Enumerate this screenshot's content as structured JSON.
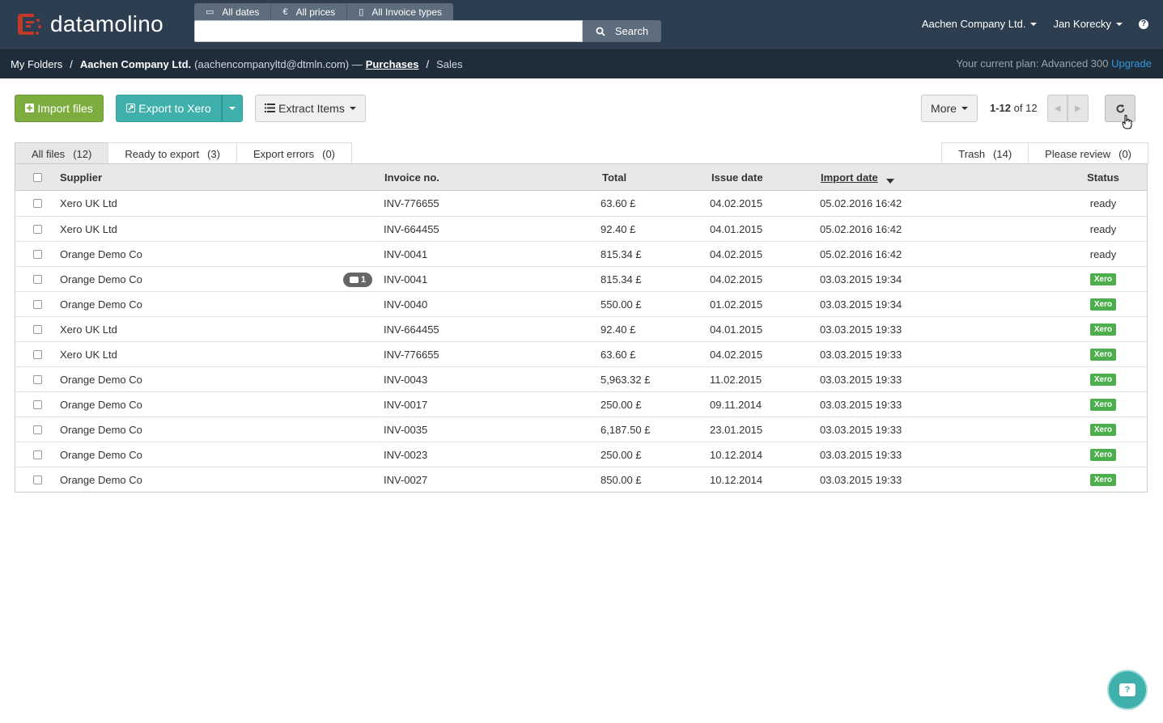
{
  "app": {
    "logo_text": "datamolino",
    "brand_color": "#c0392b"
  },
  "filters": [
    {
      "icon": "calendar-icon",
      "glyph": "▭",
      "label": "All dates"
    },
    {
      "icon": "euro-icon",
      "glyph": "€",
      "label": "All prices"
    },
    {
      "icon": "file-icon",
      "glyph": "▯",
      "label": "All Invoice types"
    }
  ],
  "search": {
    "value": "",
    "placeholder": "",
    "button_label": "Search"
  },
  "topnav": {
    "company": "Aachen Company Ltd.",
    "user": "Jan Korecky",
    "help": "?"
  },
  "breadcrumb": {
    "root": "My Folders",
    "company": "Aachen Company Ltd.",
    "email": "(aachencompanyltd@dtmln.com) —",
    "purchases": "Purchases",
    "sales": "Sales",
    "plan_text": "Your current plan: Advanced 300",
    "upgrade": "Upgrade"
  },
  "toolbar": {
    "import_label": "Import files",
    "export_label": "Export to Xero",
    "extract_label": "Extract Items",
    "more_label": "More",
    "pager_range": "1-12",
    "pager_of": "of 12"
  },
  "tabs": [
    {
      "label": "All files",
      "count": "(12)"
    },
    {
      "label": "Ready to export",
      "count": "(3)"
    },
    {
      "label": "Export errors",
      "count": "(0)"
    }
  ],
  "tabs_right": [
    {
      "label": "Trash",
      "count": "(14)"
    },
    {
      "label": "Please review",
      "count": "(0)"
    }
  ],
  "table": {
    "columns": {
      "supplier": "Supplier",
      "invoice": "Invoice no.",
      "total": "Total",
      "issue": "Issue date",
      "import": "Import date",
      "status": "Status"
    },
    "rows": [
      {
        "supplier": "Xero UK Ltd",
        "invoice": "INV-776655",
        "total": "63.60 £",
        "issue": "04.02.2015",
        "import": "05.02.2016 16:42",
        "status": "ready",
        "comments": ""
      },
      {
        "supplier": "Xero UK Ltd",
        "invoice": "INV-664455",
        "total": "92.40 £",
        "issue": "04.01.2015",
        "import": "05.02.2016 16:42",
        "status": "ready",
        "comments": ""
      },
      {
        "supplier": "Orange Demo Co",
        "invoice": "INV-0041",
        "total": "815.34 £",
        "issue": "04.02.2015",
        "import": "05.02.2016 16:42",
        "status": "ready",
        "comments": ""
      },
      {
        "supplier": "Orange Demo Co",
        "invoice": "INV-0041",
        "total": "815.34 £",
        "issue": "04.02.2015",
        "import": "03.03.2015 19:34",
        "status": "Xero",
        "comments": "1"
      },
      {
        "supplier": "Orange Demo Co",
        "invoice": "INV-0040",
        "total": "550.00 £",
        "issue": "01.02.2015",
        "import": "03.03.2015 19:34",
        "status": "Xero",
        "comments": ""
      },
      {
        "supplier": "Xero UK Ltd",
        "invoice": "INV-664455",
        "total": "92.40 £",
        "issue": "04.01.2015",
        "import": "03.03.2015 19:33",
        "status": "Xero",
        "comments": ""
      },
      {
        "supplier": "Xero UK Ltd",
        "invoice": "INV-776655",
        "total": "63.60 £",
        "issue": "04.02.2015",
        "import": "03.03.2015 19:33",
        "status": "Xero",
        "comments": ""
      },
      {
        "supplier": "Orange Demo Co",
        "invoice": "INV-0043",
        "total": "5,963.32 £",
        "issue": "11.02.2015",
        "import": "03.03.2015 19:33",
        "status": "Xero",
        "comments": ""
      },
      {
        "supplier": "Orange Demo Co",
        "invoice": "INV-0017",
        "total": "250.00 £",
        "issue": "09.11.2014",
        "import": "03.03.2015 19:33",
        "status": "Xero",
        "comments": ""
      },
      {
        "supplier": "Orange Demo Co",
        "invoice": "INV-0035",
        "total": "6,187.50 £",
        "issue": "23.01.2015",
        "import": "03.03.2015 19:33",
        "status": "Xero",
        "comments": ""
      },
      {
        "supplier": "Orange Demo Co",
        "invoice": "INV-0023",
        "total": "250.00 £",
        "issue": "10.12.2014",
        "import": "03.03.2015 19:33",
        "status": "Xero",
        "comments": ""
      },
      {
        "supplier": "Orange Demo Co",
        "invoice": "INV-0027",
        "total": "850.00 £",
        "issue": "10.12.2014",
        "import": "03.03.2015 19:33",
        "status": "Xero",
        "comments": ""
      }
    ]
  },
  "chat": {
    "icon": "chat-help-icon",
    "glyph": "?"
  }
}
